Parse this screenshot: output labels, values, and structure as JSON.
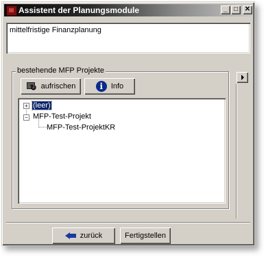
{
  "window": {
    "title": "Assistent der Planungsmodule",
    "controls": {
      "minimize": "_",
      "maximize": "□",
      "close": "✕"
    }
  },
  "description": {
    "text": "mittelfristige Finanzplanung"
  },
  "group": {
    "label": "bestehende MFP Projekte",
    "buttons": {
      "refresh": "aufrischen",
      "info": "Info"
    }
  },
  "tree": {
    "items": [
      {
        "label": "(leer)",
        "expander": "+",
        "selected": true
      },
      {
        "label": "MFP-Test-Projekt",
        "expander": "−"
      },
      {
        "label": "MFP-Test-ProjektKR"
      }
    ]
  },
  "footer": {
    "back_label": "zurück",
    "finish_label": "Fertigstellen"
  },
  "icons": [
    "app-icon",
    "refresh-icon",
    "info-icon",
    "back-arrow-icon",
    "scroll-right-icon"
  ]
}
